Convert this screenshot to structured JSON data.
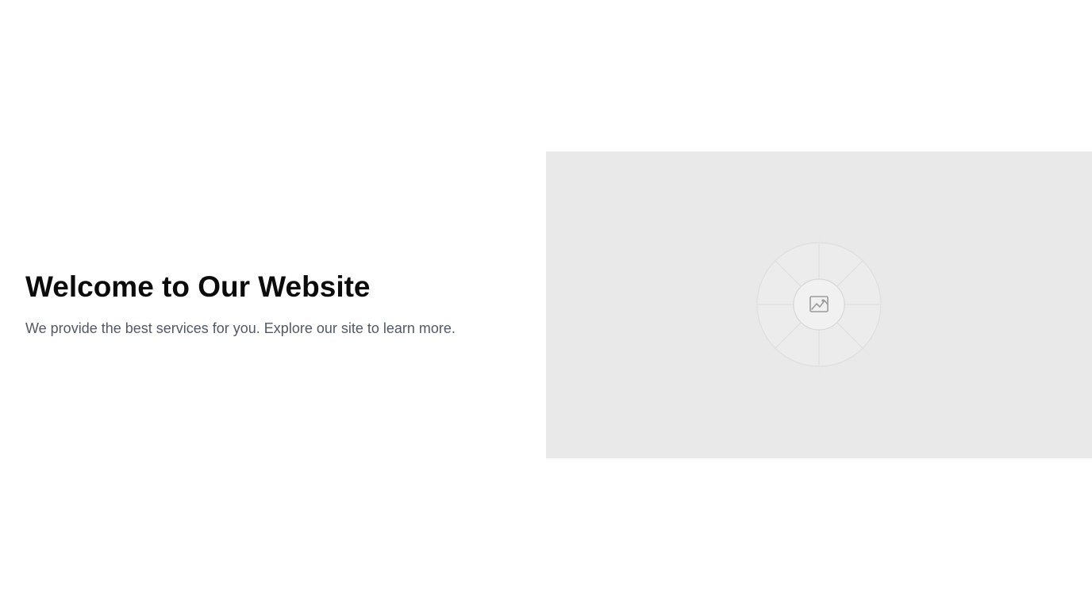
{
  "hero": {
    "title": "Welcome to Our Website",
    "subtitle": "We provide the best services for you. Explore our site to learn more."
  },
  "media": {
    "icon": "image-icon",
    "background_color": "#e9e9e9"
  },
  "colors": {
    "title": "#0b0b0b",
    "subtitle": "#525866",
    "page_background": "#ffffff"
  }
}
